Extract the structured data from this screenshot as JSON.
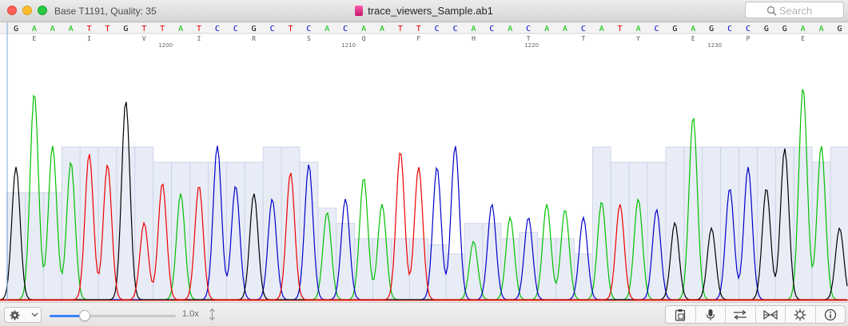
{
  "window": {
    "status": "Base T1191, Quality: 35",
    "title": "trace_viewers_Sample.ab1",
    "search_placeholder": "Search"
  },
  "colors": {
    "A": "#00c000",
    "C": "#0000cc",
    "G": "#000000",
    "T": "#ee0000"
  },
  "sequence": "GAAATTGTTATCCGCTCACAATTCCACACAACATACGAGCCGGAAG",
  "amino_acids": [
    {
      "aa": "E",
      "base": 1
    },
    {
      "aa": "I",
      "base": 4
    },
    {
      "aa": "V",
      "base": 7
    },
    {
      "aa": "I",
      "base": 10
    },
    {
      "aa": "R",
      "base": 13
    },
    {
      "aa": "S",
      "base": 16
    },
    {
      "aa": "Q",
      "base": 19
    },
    {
      "aa": "F",
      "base": 22
    },
    {
      "aa": "H",
      "base": 25
    },
    {
      "aa": "T",
      "base": 28
    },
    {
      "aa": "T",
      "base": 31
    },
    {
      "aa": "Y",
      "base": 34
    },
    {
      "aa": "E",
      "base": 37
    },
    {
      "aa": "P",
      "base": 40
    },
    {
      "aa": "E",
      "base": 43
    }
  ],
  "position_ticks": [
    {
      "label": "1200",
      "base": 8
    },
    {
      "label": "1210",
      "base": 18
    },
    {
      "label": "1220",
      "base": 28
    },
    {
      "label": "1230",
      "base": 38
    }
  ],
  "quality": [
    35,
    35,
    35,
    50,
    50,
    50,
    50,
    50,
    45,
    45,
    45,
    45,
    45,
    45,
    50,
    50,
    45,
    30,
    25,
    20,
    20,
    20,
    20,
    18,
    15,
    25,
    25,
    20,
    22,
    20,
    20,
    15,
    50,
    45,
    45,
    45,
    50,
    50,
    50,
    50,
    50,
    50,
    50,
    50,
    45,
    50
  ],
  "peaks": [
    {
      "base": "G",
      "h": 0.5
    },
    {
      "base": "A",
      "h": 0.78
    },
    {
      "base": "A",
      "h": 0.58
    },
    {
      "base": "A",
      "h": 0.52
    },
    {
      "base": "T",
      "h": 0.55
    },
    {
      "base": "T",
      "h": 0.51
    },
    {
      "base": "G",
      "h": 0.75
    },
    {
      "base": "T",
      "h": 0.29
    },
    {
      "base": "T",
      "h": 0.44
    },
    {
      "base": "A",
      "h": 0.4
    },
    {
      "base": "T",
      "h": 0.43
    },
    {
      "base": "C",
      "h": 0.58
    },
    {
      "base": "C",
      "h": 0.43
    },
    {
      "base": "G",
      "h": 0.4
    },
    {
      "base": "C",
      "h": 0.38
    },
    {
      "base": "T",
      "h": 0.48
    },
    {
      "base": "C",
      "h": 0.51
    },
    {
      "base": "A",
      "h": 0.33
    },
    {
      "base": "C",
      "h": 0.38
    },
    {
      "base": "A",
      "h": 0.46
    },
    {
      "base": "A",
      "h": 0.36
    },
    {
      "base": "T",
      "h": 0.56
    },
    {
      "base": "T",
      "h": 0.5
    },
    {
      "base": "C",
      "h": 0.5
    },
    {
      "base": "C",
      "h": 0.58
    },
    {
      "base": "A",
      "h": 0.22
    },
    {
      "base": "C",
      "h": 0.36
    },
    {
      "base": "A",
      "h": 0.31
    },
    {
      "base": "C",
      "h": 0.31
    },
    {
      "base": "A",
      "h": 0.36
    },
    {
      "base": "A",
      "h": 0.34
    },
    {
      "base": "C",
      "h": 0.31
    },
    {
      "base": "A",
      "h": 0.37
    },
    {
      "base": "T",
      "h": 0.36
    },
    {
      "base": "A",
      "h": 0.38
    },
    {
      "base": "C",
      "h": 0.34
    },
    {
      "base": "G",
      "h": 0.29
    },
    {
      "base": "A",
      "h": 0.69
    },
    {
      "base": "G",
      "h": 0.27
    },
    {
      "base": "C",
      "h": 0.42
    },
    {
      "base": "C",
      "h": 0.5
    },
    {
      "base": "G",
      "h": 0.42
    },
    {
      "base": "G",
      "h": 0.57
    },
    {
      "base": "A",
      "h": 0.8
    },
    {
      "base": "A",
      "h": 0.58
    },
    {
      "base": "G",
      "h": 0.27
    }
  ],
  "toolbar": {
    "zoom_label": "1.0x",
    "zoom_value": 0.28,
    "tools": [
      "clipboard-icon",
      "microphone-icon",
      "shuffle-icon",
      "bowtie-icon",
      "crosshair-icon",
      "info-icon"
    ]
  }
}
